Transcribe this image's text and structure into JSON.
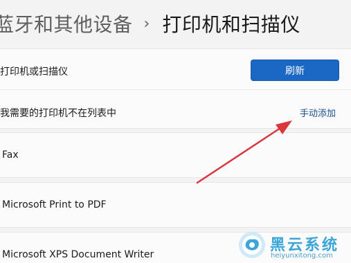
{
  "breadcrumb": {
    "parent": "蓝牙和其他设备",
    "separator": "›",
    "current": "打印机和扫描仪"
  },
  "add_device_card": {
    "label": "打印机或扫描仪",
    "refresh_label": "刷新",
    "missing_label": "我需要的打印机不在列表中",
    "manual_add_label": "手动添加"
  },
  "printers": [
    {
      "name": "Fax"
    },
    {
      "name": "Microsoft Print to PDF"
    },
    {
      "name": "Microsoft XPS Document Writer"
    }
  ],
  "watermark": {
    "text": "黑云系统",
    "url": "heiyunxitong.com"
  },
  "colors": {
    "accent": "#1a68c4",
    "link": "#1a4f8a",
    "arrow": "#d9363e",
    "watermark": "#3aa6d8"
  }
}
